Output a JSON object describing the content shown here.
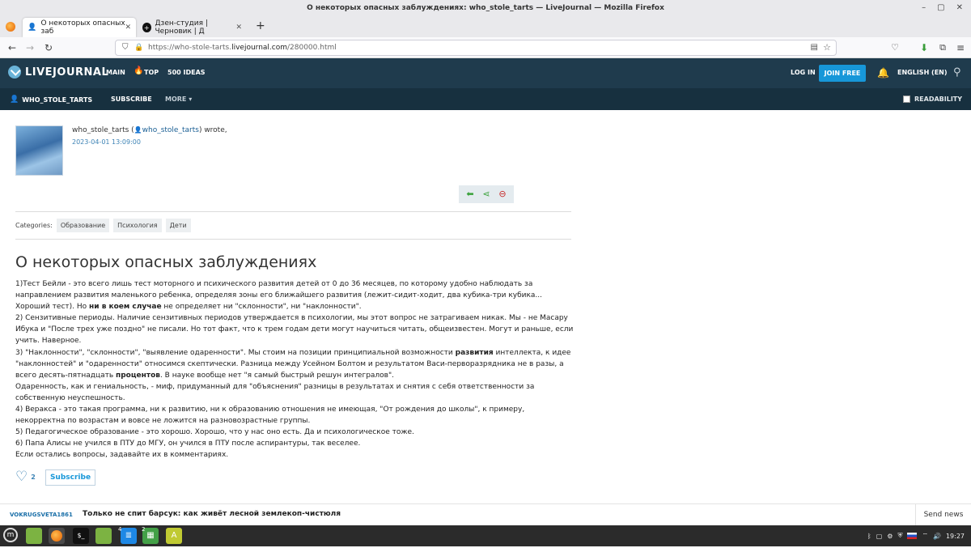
{
  "window": {
    "title": "О некоторых опасных заблуждениях: who_stole_tarts — LiveJournal — Mozilla Firefox",
    "controls": [
      "–",
      "▢",
      "✕"
    ]
  },
  "tabs": [
    {
      "label": "О некоторых опасных заб",
      "active": true
    },
    {
      "label": "Дзен-студия | Черновик | Д",
      "active": false
    }
  ],
  "new_tab_label": "+",
  "url": {
    "prefix": "https://who-stole-tarts.",
    "domain": "livejournal.com",
    "path": "/280000.html"
  },
  "lj": {
    "logo": "LIVEJOURNAL",
    "nav": [
      "MAIN",
      "TOP",
      "500 IDEAS"
    ],
    "login": "LOG IN",
    "join": "JOIN FREE",
    "language": "ENGLISH (EN)",
    "journal_user": "WHO_STOLE_TARTS",
    "subscribe": "SUBSCRIBE",
    "more": "MORE",
    "readability": "READABILITY"
  },
  "post": {
    "author_name": "who_stole_tarts",
    "author_link": "who_stole_tarts",
    "wrote": "wrote,",
    "date": "2023-04-01 13:09:00",
    "categories_label": "Categories:",
    "categories": [
      "Образование",
      "Психология",
      "Дети"
    ],
    "title": "О некоторых опасных заблуждениях",
    "p1a": "1)Тест Бейли - это всего лишь тест моторного и психического развития детей от 0 до 36 месяцев, по которому удобно наблюдать за направлением развития маленького ребенка, определяя зоны его ближайшего развития (лежит-сидит-ходит, два кубика-три кубика... Хороший тест). Но ",
    "p1b": "ни в коем случае",
    "p1c": " не определяет ни \"склонности\", ни \"наклонности\".",
    "p2": "2) Сензитивные периоды. Наличие сензитивных периодов утверждается в психологии, мы этот вопрос не затрагиваем никак. Мы - не Масару Ибука и \"После трех уже поздно\" не писали. Но тот факт, что к трем годам дети могут научиться читать, общеизвестен. Могут и раньше, если учить. Наверное.",
    "p3a": "3) \"Наклонности\", \"склонности\", \"выявление одаренности\". Мы стоим на позиции принципиальной возможности ",
    "p3b": "развития",
    "p3c": " интеллекта, к идее \"наклонностей\" и \"одаренности\" относимся скептически. Разница между Усейном Болтом и результатом Васи-перворазрядника не в разы, а всего десять-пятнадцать ",
    "p3d": "процентов",
    "p3e": ". В науке вообще нет \"я самый быстрый решун интегралов\".",
    "p3f": "Одаренность, как и гениальность, - миф, придуманный для \"объяснения\" разницы в результатах и снятия с себя ответственности за собственную неуспешность.",
    "p4": "4) Веракса - это такая программа, ни к развитию, ни к образованию отношения не имеющая, \"От рождения до школы\", к примеру, некорректна по возрастам и вовсе не ложится на разновозрастные группы.",
    "p5": "5) Педагогическое образование - это хорошо. Хорошо, что у нас оно есть. Да и психологическое тоже.",
    "p6": "6) Папа Алисы не учился в ПТУ до МГУ, он учился в ПТУ после аспирантуры, так веселее.",
    "p7": "Если остались вопросы, задавайте их в комментариях.",
    "likes": "2",
    "subscribe_button": "Subscribe"
  },
  "footer": {
    "user": "VOKRUGSVETA1861",
    "headline": "Только не спит барсук: как живёт лесной землекоп-чистюля",
    "send_news": "Send news"
  },
  "taskbar": {
    "clock": "19:27",
    "badges": [
      "4",
      "2"
    ]
  },
  "colors": {
    "lj_header": "#1f3b4d",
    "lj_sub": "#17303f",
    "accent": "#1797d9"
  }
}
